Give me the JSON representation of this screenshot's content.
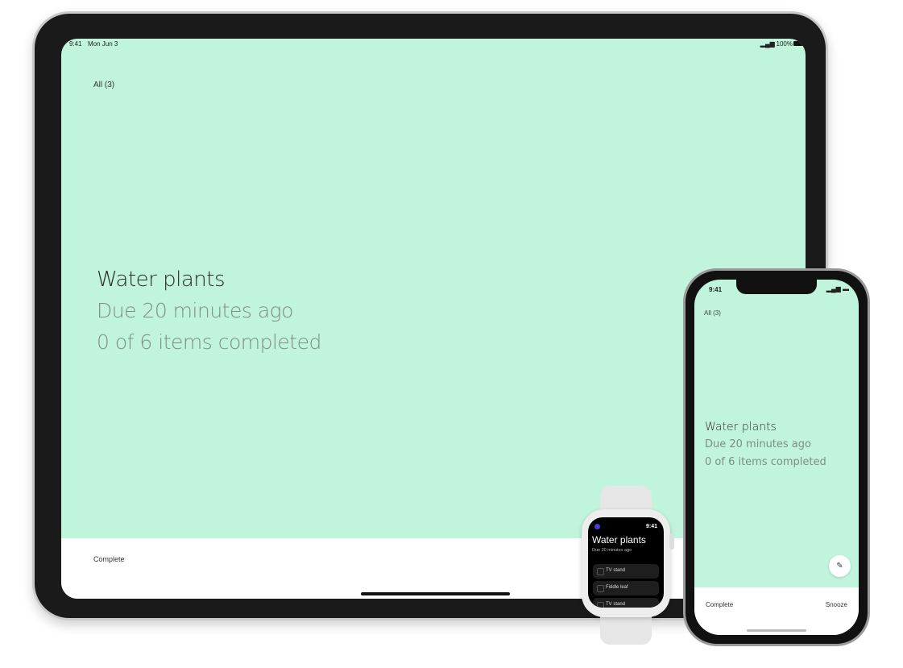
{
  "ipad": {
    "status": {
      "time": "9:41",
      "date": "Mon Jun 3",
      "battery": "100%"
    },
    "filter": "All (3)",
    "task": {
      "title": "Water plants",
      "due": "Due 20 minutes ago",
      "progress": "0 of 6 items completed"
    },
    "complete_label": "Complete"
  },
  "iphone": {
    "status": {
      "time": "9:41"
    },
    "filter": "All (3)",
    "task": {
      "title": "Water plants",
      "due": "Due 20 minutes ago",
      "progress": "0 of 6 items completed"
    },
    "complete_label": "Complete",
    "snooze_label": "Snooze"
  },
  "watch": {
    "time": "9:41",
    "title": "Water plants",
    "due": "Due 20 minutes ago",
    "items": [
      "TV stand",
      "Fiddle leaf",
      "TV stand"
    ]
  },
  "colors": {
    "background": "#c1f4dc",
    "watch_accent": "#4a3fd1"
  }
}
